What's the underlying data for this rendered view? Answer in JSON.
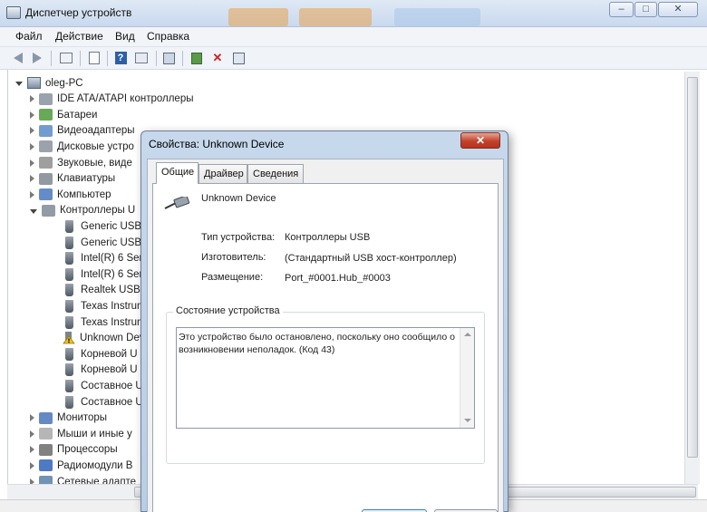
{
  "window": {
    "title": "Диспетчер устройств",
    "controls": {
      "minimize": "–",
      "maximize": "□",
      "close": "✕"
    }
  },
  "menu": [
    "Файл",
    "Действие",
    "Вид",
    "Справка"
  ],
  "toolbar_icons": [
    "back-arrow-icon",
    "forward-arrow-icon",
    "show-hide-tree-icon",
    "properties-sheet-icon",
    "help-icon",
    "view-icon",
    "scan-hardware-icon",
    "update-driver-icon",
    "uninstall-icon",
    "disable-device-icon"
  ],
  "tree": {
    "root": "oleg-PC",
    "items": [
      {
        "label": "IDE ATA/ATAPI контроллеры",
        "icon": "disk-controller-icon"
      },
      {
        "label": "Батареи",
        "icon": "battery-icon"
      },
      {
        "label": "Видеоадаптеры",
        "icon": "display-adapter-icon"
      },
      {
        "label": "Дисковые устро",
        "icon": "disk-drive-icon"
      },
      {
        "label": "Звуковые, виде",
        "icon": "sound-icon"
      },
      {
        "label": "Клавиатуры",
        "icon": "keyboard-icon"
      },
      {
        "label": "Компьютер",
        "icon": "computer-icon"
      },
      {
        "label": "Контроллеры U",
        "icon": "usb-icon",
        "expanded": true,
        "children": [
          {
            "label": "Generic USB"
          },
          {
            "label": "Generic USB"
          },
          {
            "label": "Intel(R) 6 Seri"
          },
          {
            "label": "Intel(R) 6 Seri"
          },
          {
            "label": "Realtek USB"
          },
          {
            "label": "Texas Instrum"
          },
          {
            "label": "Texas Instrum"
          },
          {
            "label": "Unknown Dev",
            "warning": true
          },
          {
            "label": "Корневой U"
          },
          {
            "label": "Корневой U"
          },
          {
            "label": "Составное U"
          },
          {
            "label": "Составное U"
          }
        ]
      },
      {
        "label": "Мониторы",
        "icon": "monitor-icon"
      },
      {
        "label": "Мыши и иные у",
        "icon": "mouse-icon"
      },
      {
        "label": "Процессоры",
        "icon": "processor-icon"
      },
      {
        "label": "Радиомодули B",
        "icon": "bluetooth-icon"
      },
      {
        "label": "Сетевые адапте",
        "icon": "network-icon"
      }
    ]
  },
  "dialog": {
    "title": "Свойства: Unknown Device",
    "close": "✕",
    "tabs": [
      "Общие",
      "Драйвер",
      "Сведения"
    ],
    "device_name": "Unknown Device",
    "properties": [
      {
        "label": "Тип устройства:",
        "value": "Контроллеры USB"
      },
      {
        "label": "Изготовитель:",
        "value": "(Стандартный USB хост-контроллер)"
      },
      {
        "label": "Размещение:",
        "value": "Port_#0001.Hub_#0003"
      }
    ],
    "status_title": "Состояние устройства",
    "status_text": "Это устройство было остановлено, поскольку оно сообщило о возникновении неполадок. (Код 43)"
  },
  "colors": {
    "accent": "#3c7fb1",
    "titlebar": "#c9d9ee",
    "close": "#c3422b"
  }
}
